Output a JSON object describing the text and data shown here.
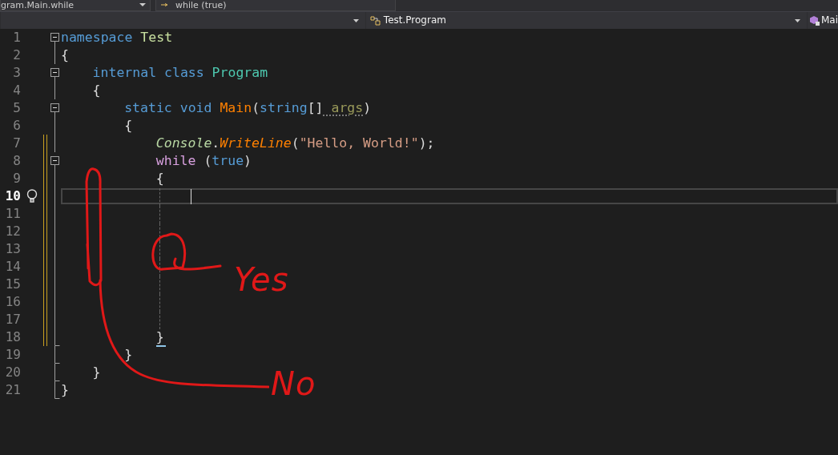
{
  "navigation_bar_top": {
    "member_dropdown": "gram.Main.while",
    "scope_dropdown": "while (true)"
  },
  "navigation_bar": {
    "type_dropdown": {
      "value": "Test.Program"
    },
    "member_dropdown": {
      "value": "Mai"
    }
  },
  "editor": {
    "lines": [
      {
        "number": "1",
        "kind": "start",
        "expanded": true,
        "changed": false,
        "current": false,
        "lightbulb": false,
        "tokens": [
          {
            "text": "namespace",
            "kind": "keyword"
          },
          {
            "text": " Test",
            "kind": "namespace"
          }
        ]
      },
      {
        "number": "2",
        "kind": "inner",
        "changed": false,
        "current": false,
        "lightbulb": false,
        "tokens": [
          {
            "text": "{",
            "kind": "punct"
          }
        ]
      },
      {
        "number": "3",
        "kind": "start",
        "expanded": true,
        "changed": false,
        "current": false,
        "lightbulb": false,
        "tokens": [
          {
            "text": "internal",
            "kind": "keyword"
          },
          {
            "text": " class",
            "kind": "keyword"
          },
          {
            "text": " Program",
            "kind": "type"
          }
        ]
      },
      {
        "number": "4",
        "kind": "inner",
        "changed": false,
        "current": false,
        "lightbulb": false,
        "tokens": [
          {
            "text": "{",
            "kind": "punct"
          }
        ]
      },
      {
        "number": "5",
        "kind": "start",
        "expanded": true,
        "changed": false,
        "current": false,
        "lightbulb": false,
        "tokens": [
          {
            "text": "static",
            "kind": "keyword"
          },
          {
            "text": " void",
            "kind": "keyword"
          },
          {
            "text": " Main",
            "kind": "method"
          },
          {
            "text": "(",
            "kind": "punct"
          },
          {
            "text": "string",
            "kind": "keyword"
          },
          {
            "text": "[]",
            "kind": "punct"
          },
          {
            "text": " args",
            "kind": "parameter"
          },
          {
            "text": ")",
            "kind": "punct"
          }
        ]
      },
      {
        "number": "6",
        "kind": "inner",
        "changed": false,
        "current": false,
        "lightbulb": false,
        "tokens": [
          {
            "text": "{",
            "kind": "punct"
          }
        ]
      },
      {
        "number": "7",
        "kind": "inner",
        "changed": true,
        "current": false,
        "lightbulb": false,
        "tokens": [
          {
            "text": "Console",
            "kind": "static-type"
          },
          {
            "text": ".",
            "kind": "punct"
          },
          {
            "text": "WriteLine",
            "kind": "static-method"
          },
          {
            "text": "(",
            "kind": "punct"
          },
          {
            "text": "\"Hello, World!\"",
            "kind": "string"
          },
          {
            "text": ");",
            "kind": "punct"
          }
        ]
      },
      {
        "number": "8",
        "kind": "start",
        "expanded": true,
        "changed": true,
        "current": false,
        "lightbulb": false,
        "tokens": [
          {
            "text": "while",
            "kind": "control"
          },
          {
            "text": " (",
            "kind": "punct"
          },
          {
            "text": "true",
            "kind": "keyword"
          },
          {
            "text": ")",
            "kind": "punct"
          }
        ]
      },
      {
        "number": "9",
        "kind": "inner",
        "changed": true,
        "current": false,
        "lightbulb": false,
        "tokens": [
          {
            "text": "{",
            "kind": "punct"
          }
        ]
      },
      {
        "number": "10",
        "kind": "inner",
        "changed": true,
        "current": true,
        "lightbulb": true
      },
      {
        "number": "11",
        "kind": "inner",
        "changed": true,
        "current": false,
        "lightbulb": false
      },
      {
        "number": "12",
        "kind": "inner",
        "changed": true,
        "current": false,
        "lightbulb": false
      },
      {
        "number": "13",
        "kind": "inner",
        "changed": true,
        "current": false,
        "lightbulb": false
      },
      {
        "number": "14",
        "kind": "inner",
        "changed": true,
        "current": false,
        "lightbulb": false
      },
      {
        "number": "15",
        "kind": "inner",
        "changed": true,
        "current": false,
        "lightbulb": false
      },
      {
        "number": "16",
        "kind": "inner",
        "changed": true,
        "current": false,
        "lightbulb": false
      },
      {
        "number": "17",
        "kind": "inner",
        "changed": true,
        "current": false,
        "lightbulb": false
      },
      {
        "number": "18",
        "kind": "end",
        "changed": true,
        "current": false,
        "lightbulb": false,
        "tokens": [
          {
            "text": "}",
            "kind": "punct"
          }
        ]
      },
      {
        "number": "19",
        "kind": "end",
        "changed": false,
        "current": false,
        "lightbulb": false,
        "tokens": [
          {
            "text": "}",
            "kind": "punct"
          }
        ]
      },
      {
        "number": "20",
        "kind": "end",
        "changed": false,
        "current": false,
        "lightbulb": false,
        "tokens": [
          {
            "text": "}",
            "kind": "punct"
          }
        ]
      },
      {
        "number": "21",
        "kind": "end",
        "changed": false,
        "current": false,
        "lightbulb": false,
        "tokens": [
          {
            "text": "}",
            "kind": "punct"
          }
        ]
      }
    ]
  },
  "annotations": [
    {
      "text": "Yes"
    },
    {
      "text": "No"
    }
  ]
}
